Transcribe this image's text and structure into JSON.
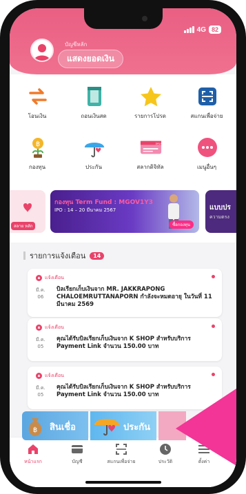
{
  "status_bar": {
    "network": "4G",
    "battery": "82"
  },
  "header": {
    "account_label": "บัญชีหลัก",
    "balance_button": "แสดงยอดเงิน"
  },
  "menu": [
    {
      "label": "โอนเงิน",
      "icon": "transfer-icon"
    },
    {
      "label": "ถอนเงินสด",
      "icon": "atm-withdraw-icon"
    },
    {
      "label": "รายการโปรด",
      "icon": "star-icon"
    },
    {
      "label": "สแกนเพื่อจ่าย",
      "icon": "scan-icon"
    },
    {
      "label": "กองทุน",
      "icon": "fund-plant-icon"
    },
    {
      "label": "ประกัน",
      "icon": "umbrella-icon"
    },
    {
      "label": "สลากดิจิทัล",
      "icon": "lottery-ticket-icon"
    },
    {
      "label": "เมนูอื่นๆ",
      "icon": "more-dots-icon"
    }
  ],
  "banners": {
    "left_tag": "สลาย หลัก",
    "fund_title": "กองทุน Term Fund : MGOV1Y3",
    "fund_ipo": "IPO : 14 – 20 มีนาคม 2567",
    "fund_button": "ซื้อกองทุน",
    "right_title": "แบบปร",
    "right_sub": "ความตรง"
  },
  "notifications": {
    "title": "รายการแจ้งเตือน",
    "count": "14",
    "items": [
      {
        "tag": "แจ้งเตือน",
        "date_line1": "มี.ค.",
        "date_line2": "06",
        "message": "บิลเรียกเก็บเงินจาก MR. JAKKRAPONG CHALOEMRUTTANAPORN กำลังจะหมดอายุ ในวันที่ 11 มีนาคม 2569"
      },
      {
        "tag": "แจ้งเตือน",
        "date_line1": "มี.ค.",
        "date_line2": "05",
        "message": "คุณได้รับบิลเรียกเก็บเงินจาก K SHOP สำหรับบริการ Payment Link จำนวน 150.00 บาท"
      },
      {
        "tag": "แจ้งเตือน",
        "date_line1": "มี.ค.",
        "date_line2": "05",
        "message": "คุณได้รับบิลเรียกเก็บเงินจาก K SHOP สำหรับบริการ Payment Link จำนวน 150.00 บาท"
      }
    ]
  },
  "promo": {
    "loan": "สินเชื่อ",
    "insurance": "ประกัน"
  },
  "tabs": [
    {
      "label": "หน้าแรก",
      "icon": "home-icon",
      "active": true
    },
    {
      "label": "บัญชี",
      "icon": "wallet-icon",
      "active": false
    },
    {
      "label": "สแกนเพื่อจ่าย",
      "icon": "scan-icon",
      "active": false
    },
    {
      "label": "ประวัติ",
      "icon": "clock-icon",
      "active": false
    },
    {
      "label": "ตั้งค่า",
      "icon": "menu-icon",
      "active": false
    }
  ],
  "colors": {
    "brand": "#e9436a",
    "header": "#ee6a8a",
    "arrow": "#f23597"
  }
}
